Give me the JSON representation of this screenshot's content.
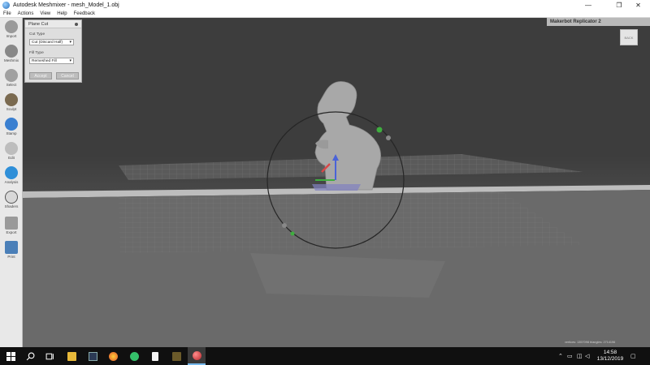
{
  "window": {
    "title": "Autodesk Meshmixer - mesh_Model_1.obj",
    "min_glyph": "—",
    "max_glyph": "❐",
    "close_glyph": "✕"
  },
  "menu": [
    "File",
    "Actions",
    "View",
    "Help",
    "Feedback"
  ],
  "toolbar": [
    {
      "label": "Import",
      "icon": "import-icon",
      "color": "#9a9a9a"
    },
    {
      "label": "Meshmix",
      "icon": "meshmix-icon",
      "color": "#888888"
    },
    {
      "label": "Select",
      "icon": "select-icon",
      "color": "#a0a0a0"
    },
    {
      "label": "Sculpt",
      "icon": "sculpt-icon",
      "color": "#7a6a50"
    },
    {
      "label": "Stamp",
      "icon": "stamp-icon",
      "color": "#3a7fd0"
    },
    {
      "label": "Edit",
      "icon": "edit-icon",
      "color": "#bdbdbd"
    },
    {
      "label": "Analysis",
      "icon": "analysis-icon",
      "color": "#2f8fd8"
    },
    {
      "label": "Shaders",
      "icon": "shaders-icon",
      "color": "#d8d8d8"
    },
    {
      "label": "Export",
      "icon": "export-icon",
      "color": "#9a9a9a"
    },
    {
      "label": "Print",
      "icon": "print-icon",
      "color": "#4a7fb8"
    }
  ],
  "panel": {
    "title": "Plane Cut",
    "cut_type_label": "Cut Type",
    "cut_type_value": "Cut (Discard Half)",
    "fill_type_label": "Fill Type",
    "fill_type_value": "Remeshed Fill",
    "accept_label": "Accept",
    "cancel_label": "Cancel"
  },
  "printer": {
    "name": "Makerbot Replicator 2"
  },
  "viewcube": {
    "label": "BACK"
  },
  "status": {
    "text": "vertices: 1357098 triangles: 2714196"
  },
  "taskbar": {
    "time": "14:58",
    "date": "13/12/2019",
    "apps": [
      {
        "name": "start-icon"
      },
      {
        "name": "search-icon"
      },
      {
        "name": "task-view-icon"
      },
      {
        "name": "file-explorer-icon"
      },
      {
        "name": "terminal-icon"
      },
      {
        "name": "firefox-icon"
      },
      {
        "name": "send-icon"
      },
      {
        "name": "document-icon"
      },
      {
        "name": "game-icon"
      },
      {
        "name": "meshmixer-icon"
      }
    ]
  }
}
